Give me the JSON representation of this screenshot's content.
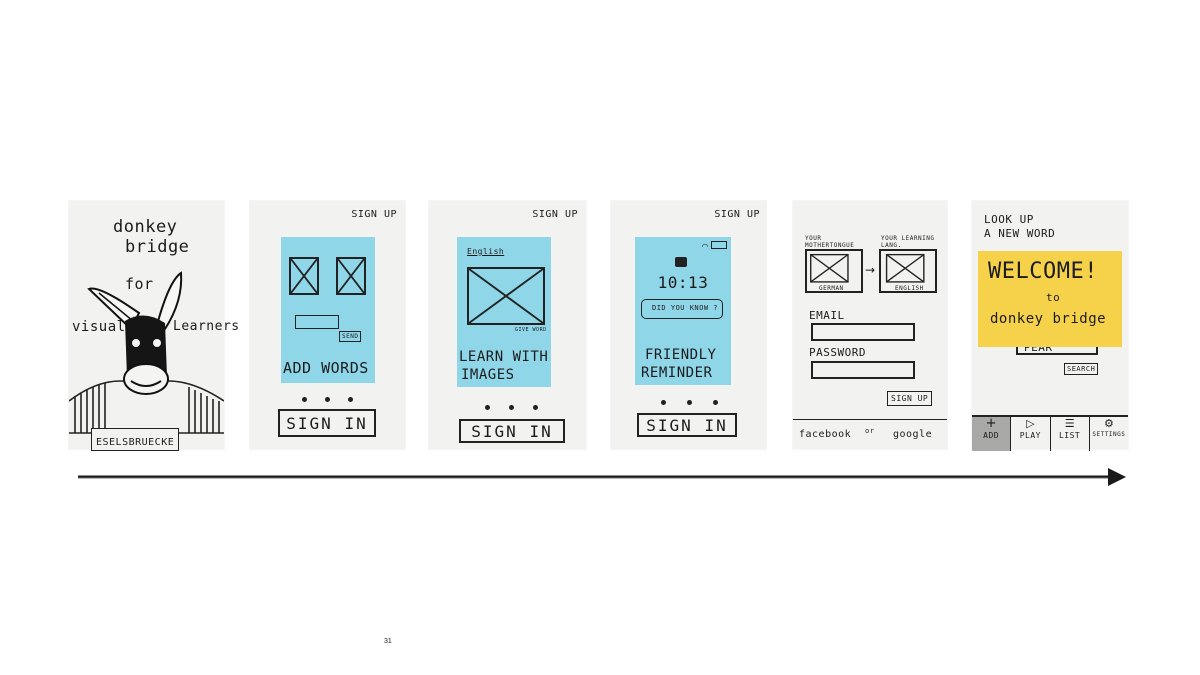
{
  "cards": {
    "logo": {
      "title_line1": "donkey",
      "title_line2": "bridge",
      "for": "for",
      "visual": "visual",
      "learners": "Learners",
      "brand": "ESELSBRUECKE"
    },
    "add_words": {
      "signup": "SIGN UP",
      "tiny_button": "SEND",
      "caption": "ADD WORDS",
      "sign_in": "SIGN IN"
    },
    "learn_images": {
      "signup": "SIGN UP",
      "lang_label": "English",
      "tiny_caption": "GIVE WORD",
      "caption_line1": "LEARN WITH",
      "caption_line2": "IMAGES",
      "sign_in": "SIGN IN"
    },
    "reminder": {
      "signup": "SIGN UP",
      "time": "10:13",
      "notification": "DID YOU KNOW ?",
      "caption_line1": "FRIENDLY",
      "caption_line2": "REMINDER",
      "sign_in": "SIGN IN"
    },
    "signup_form": {
      "mother_label": "YOUR MOTHERTONGUE",
      "learning_label": "YOUR LEARNING LANG.",
      "mother_value": "GERMAN",
      "learning_value": "ENGLISH",
      "email_label": "EMAIL",
      "password_label": "PASSWORD",
      "signup_button": "SIGN UP",
      "facebook": "facebook",
      "or": "or",
      "google": "google"
    },
    "home": {
      "lookup_line1": "LOOK UP",
      "lookup_line2": "A NEW WORD",
      "welcome": "WELCOME!",
      "to": "to",
      "app_name": "donkey bridge",
      "search_value": "PEAR",
      "search_button": "SEARCH",
      "tabs": [
        {
          "label": "ADD",
          "icon": "plus-icon"
        },
        {
          "label": "PLAY",
          "icon": "play-icon"
        },
        {
          "label": "LIST",
          "icon": "list-icon"
        },
        {
          "label": "SETTINGS",
          "icon": "gear-icon"
        }
      ]
    }
  },
  "page_number": "31",
  "colors": {
    "sticky_blue": "#8fd6e8",
    "sticky_yellow": "#f6d24a",
    "paper": "#f2f2f0",
    "ink": "#1c1c1c"
  }
}
